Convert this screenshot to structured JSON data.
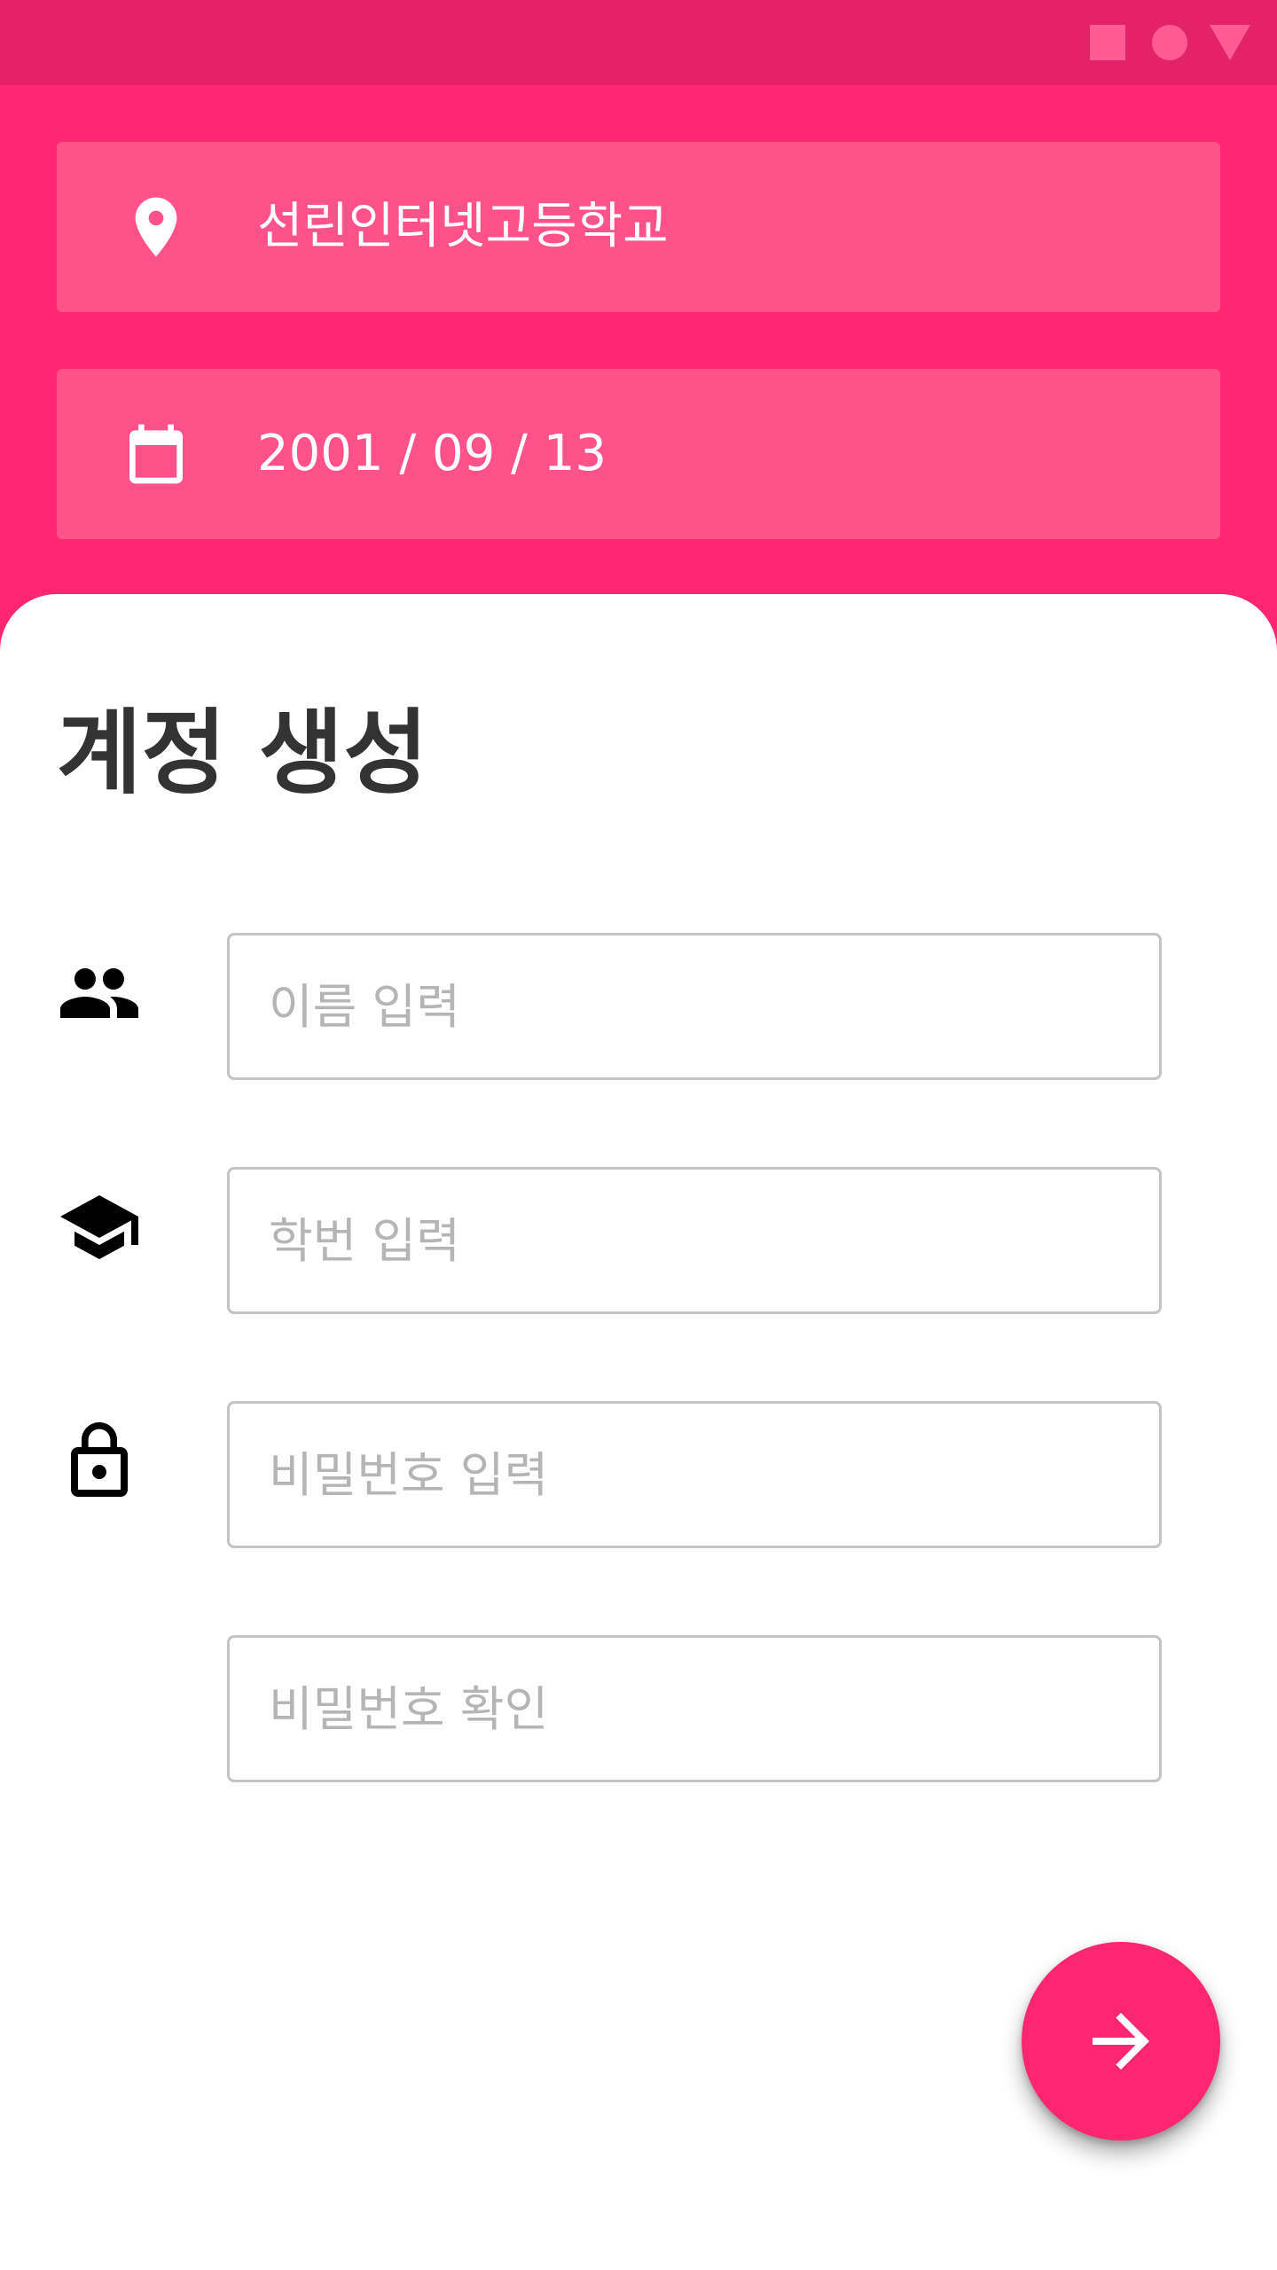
{
  "theme": {
    "accent": "#ff2671",
    "status_bar": "#e32268",
    "card": "#ff5289",
    "status_icons": "#ff5a92",
    "title_text": "#333333",
    "placeholder_text": "#b5b5b5",
    "field_border": "#c4c4c4"
  },
  "status_bar": {
    "icons": [
      "square-icon",
      "circle-icon",
      "triangle-icon"
    ]
  },
  "school_card": {
    "icon": "location-pin-icon",
    "text": "선린인터넷고등학교"
  },
  "date_card": {
    "icon": "calendar-icon",
    "text": "2001 / 09 / 13"
  },
  "form": {
    "title": "계정 생성",
    "name_field": {
      "icon": "people-icon",
      "placeholder": "이름 입력",
      "value": ""
    },
    "student_id_field": {
      "icon": "graduation-cap-icon",
      "placeholder": "학번 입력",
      "value": ""
    },
    "password_field": {
      "icon": "lock-icon",
      "placeholder": "비밀번호 입력",
      "value": ""
    },
    "password_confirm_field": {
      "placeholder": "비밀번호 확인",
      "value": ""
    },
    "next_button": {
      "icon": "arrow-right-icon"
    }
  }
}
